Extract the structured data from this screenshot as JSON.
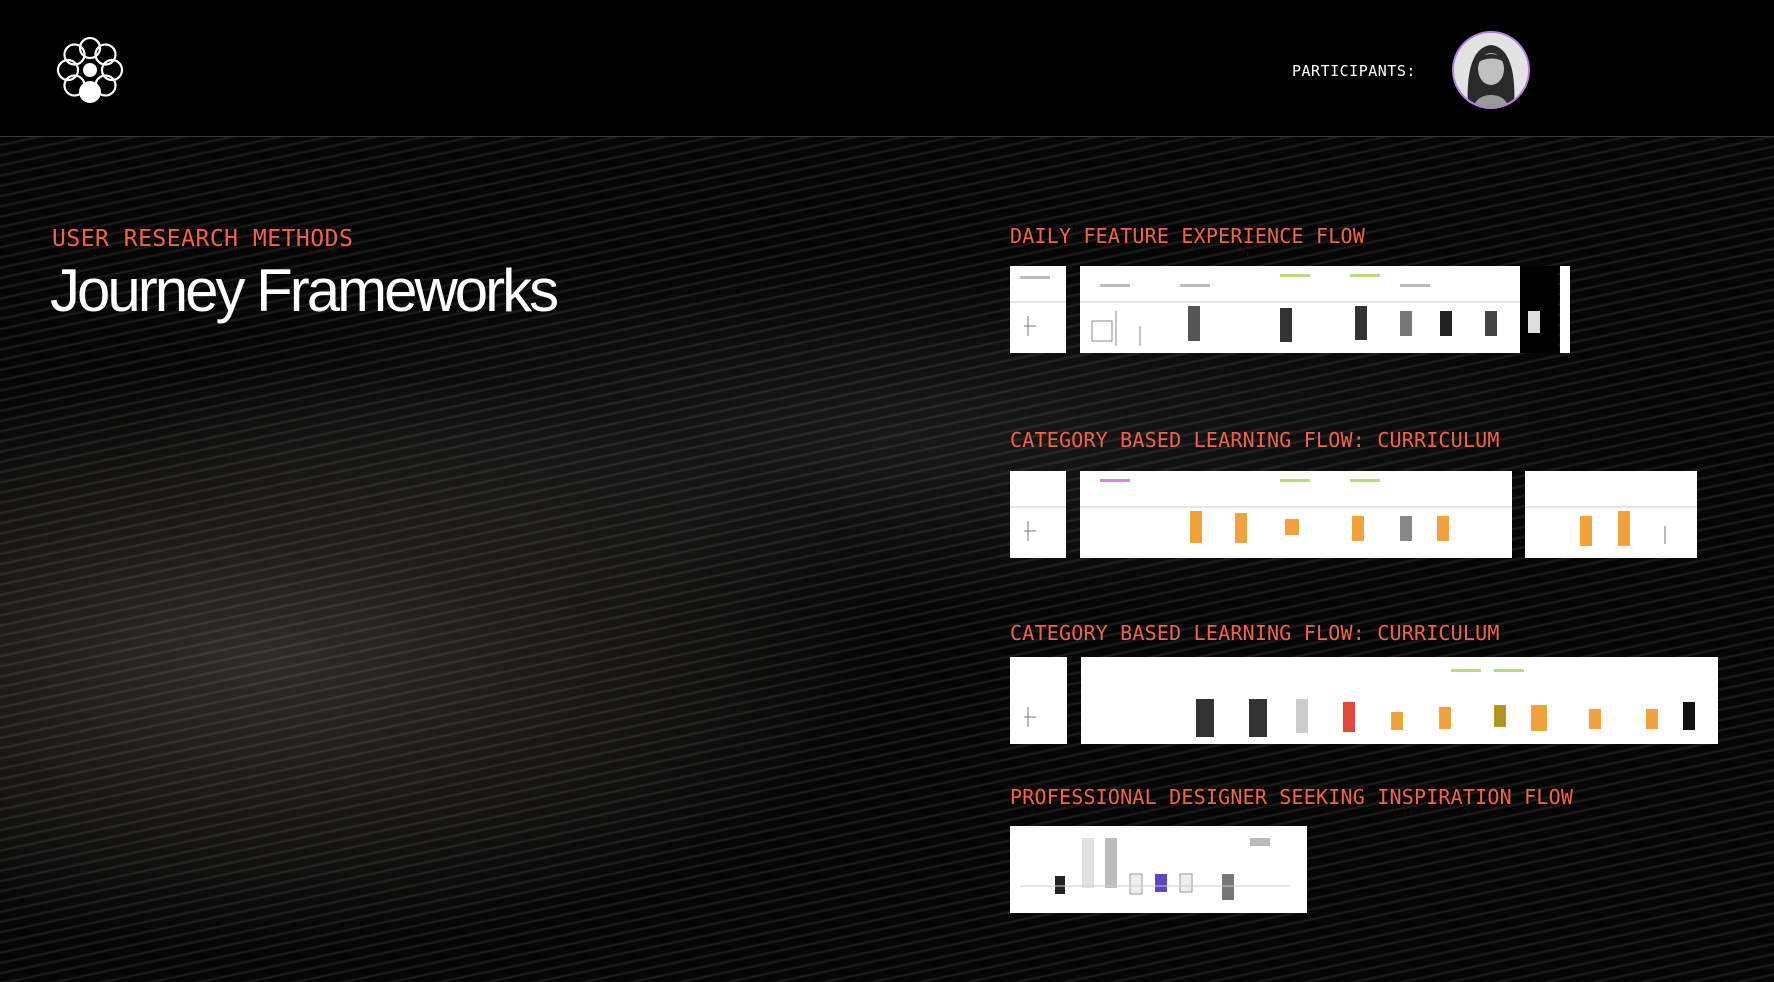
{
  "header": {
    "logo": "flower-logo",
    "participants_label": "PARTICIPANTS:",
    "avatar": "participant-avatar"
  },
  "hero": {
    "kicker": "USER RESEARCH METHODS",
    "title": "Journey Frameworks"
  },
  "flows": [
    {
      "title": "DAILY FEATURE EXPERIENCE FLOW"
    },
    {
      "title": "CATEGORY BASED LEARNING FLOW: CURRICULUM"
    },
    {
      "title": "CATEGORY BASED LEARNING FLOW: CURRICULUM"
    },
    {
      "title": "PROFESSIONAL DESIGNER SEEKING INSPIRATION FLOW"
    }
  ],
  "colors": {
    "accent": "#f0644a",
    "background": "#050505",
    "text": "#ffffff",
    "avatar_ring": "#b57edc",
    "thumbnail_orange": "#f2a23a"
  }
}
